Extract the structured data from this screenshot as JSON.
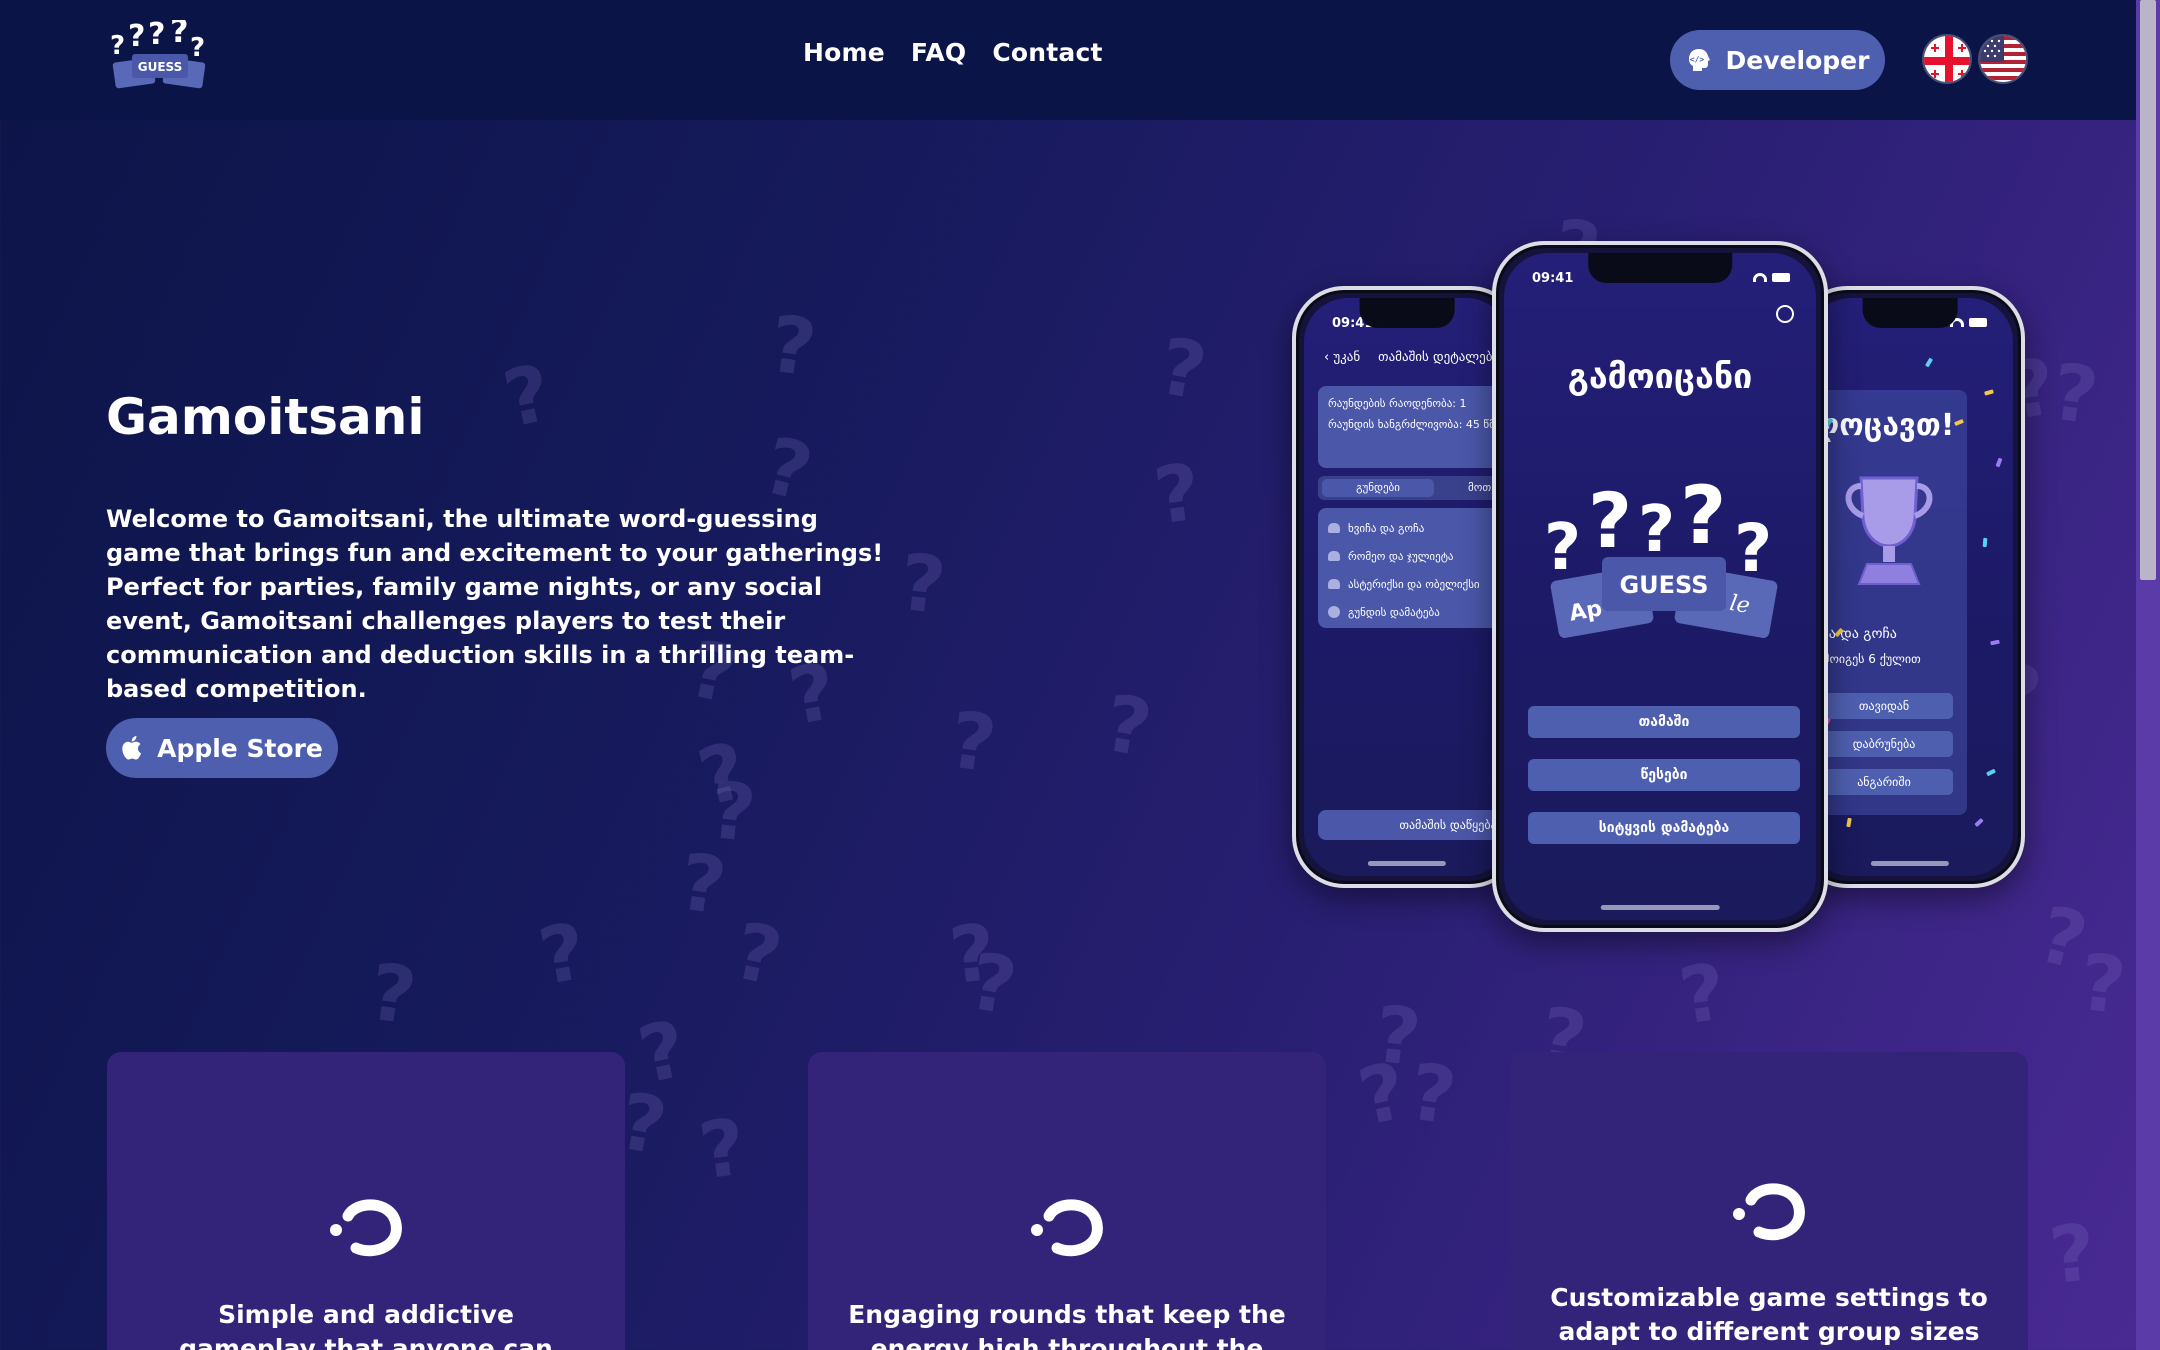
{
  "header": {
    "logo_text": "GUESS",
    "nav": [
      "Home",
      "FAQ",
      "Contact"
    ],
    "developer_label": "Developer",
    "languages": [
      "georgian-flag",
      "us-flag"
    ]
  },
  "hero": {
    "title": "Gamoitsani",
    "description": "Welcome to Gamoitsani, the ultimate word-guessing game that brings fun and excitement to your gatherings! Perfect for parties, family game nights, or any social event, Gamoitsani challenges players to test their communication and deduction skills in a thrilling team-based competition.",
    "store_button": "Apple Store"
  },
  "phones": {
    "left": {
      "time": "09:41",
      "back": "უკან",
      "screen_title": "თამაშის დეტალები",
      "rounds": "რაუნდების რაოდენობა: 1",
      "round_length": "რაუნდის ხანგრძლივობა: 45 წმ",
      "tab_teams": "გუნდები",
      "tab_other": "მოთ",
      "teams": [
        "ხვიჩა და გოჩა",
        "რომეო და ჯულიეტა",
        "ასტერიქსი და ობელიქსი"
      ],
      "add_team": "გუნდის დამატება",
      "start": "თამაშის დაწყება"
    },
    "center": {
      "time": "09:41",
      "title": "გამოიცანი",
      "logo_text": "GUESS",
      "buttons": [
        "თამაში",
        "წესები",
        "სიტყვის დამატება"
      ]
    },
    "right": {
      "title": "ლოცავთ!",
      "winner": "ვიჩა და გოჩა",
      "score": "ამ მოიგეს 6 ქულით",
      "buttons": [
        "თავიდან",
        "დაბრუნება",
        "ანგარიში"
      ]
    }
  },
  "features": [
    {
      "icon": "question-mark-icon",
      "text": "Simple and addictive gameplay that anyone can enjoy"
    },
    {
      "icon": "question-mark-icon",
      "text": "Engaging rounds that keep the energy high throughout the game"
    },
    {
      "icon": "question-mark-icon",
      "text": "Customizable game settings to adapt to different group sizes and"
    }
  ],
  "colors": {
    "header_bg": "#0b1446",
    "button": "#4f5fb0",
    "card_bg": "#332479",
    "gradient_start": "#0c1447",
    "gradient_end": "#4a2a94"
  }
}
